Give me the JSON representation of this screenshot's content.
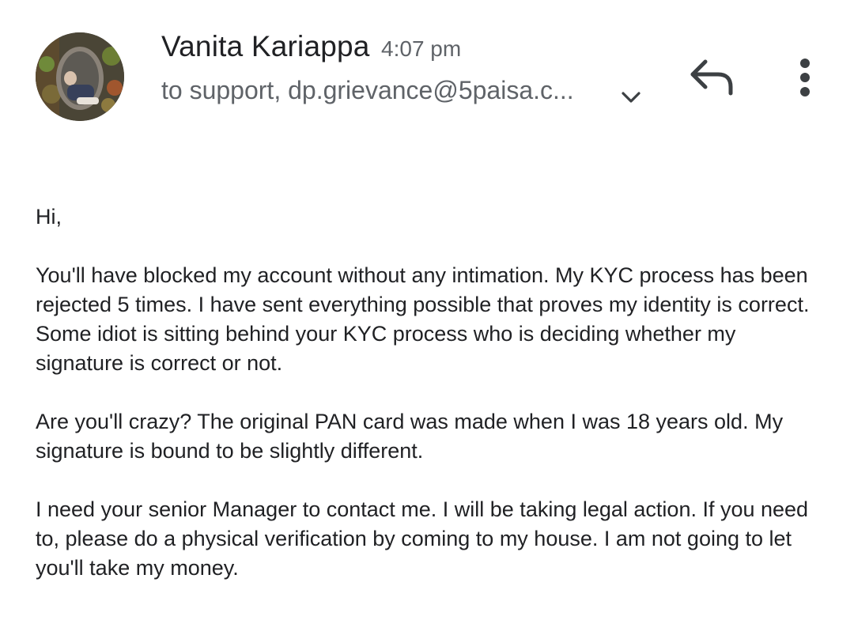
{
  "message": {
    "sender_name": "Vanita Kariappa",
    "time": "4:07 pm",
    "recipients": "to support, dp.grievance@5paisa.c...",
    "avatar_icon": "profile-photo",
    "expand_icon": "chevron-down-icon",
    "reply_icon": "reply-icon",
    "more_icon": "more-vert-icon"
  },
  "body": {
    "greeting": "Hi,",
    "paragraph_1": "You'll have blocked my account without any intimation. My KYC process has been rejected 5 times. I have sent everything possible that proves my identity is correct. Some idiot is sitting behind your KYC process who is deciding whether my signature is correct or not.",
    "paragraph_2": "Are you'll crazy? The original PAN card was made when I was 18 years old. My signature is bound to be slightly different.",
    "paragraph_3": "I need your senior Manager to contact me. I will be taking legal action. If you need to, please do a physical verification by coming to my house. I am not going to let you'll take my money."
  },
  "colors": {
    "primary_text": "#202124",
    "secondary_text": "#5f6368",
    "icon": "#3c4043",
    "background": "#ffffff"
  }
}
